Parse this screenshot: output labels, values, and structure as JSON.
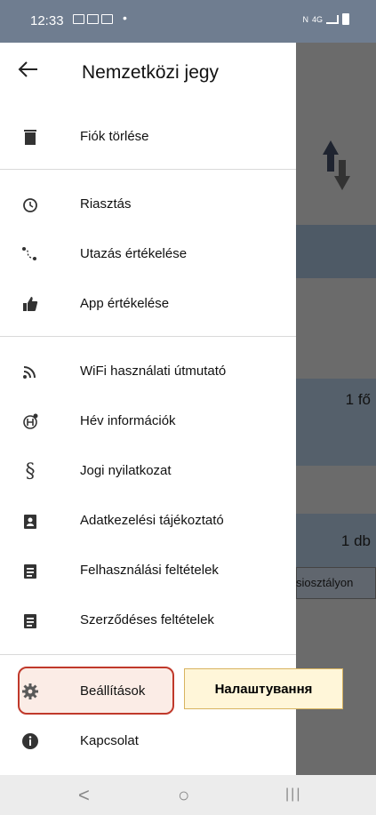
{
  "status": {
    "time": "12:33",
    "dot": "•",
    "network": "4G"
  },
  "appbar": {
    "title": "Nemzetközi jegy"
  },
  "background": {
    "persons": "1 fő",
    "count": "1 db",
    "class_partial": "siosztályon"
  },
  "menu": {
    "section1": [
      {
        "label": "Fiók törlése",
        "icon": "trash-icon"
      }
    ],
    "section2": [
      {
        "label": "Riasztás",
        "icon": "alarm-clock-icon"
      },
      {
        "label": "Utazás értékelése",
        "icon": "route-rating-icon"
      },
      {
        "label": "App értékelése",
        "icon": "thumbs-up-icon"
      }
    ],
    "section3": [
      {
        "label": "WiFi használati útmutató",
        "icon": "wifi-icon"
      },
      {
        "label": "Hév információk",
        "icon": "hev-info-icon"
      },
      {
        "label": "Jogi nyilatkozat",
        "icon": "section-sign-icon"
      },
      {
        "label": "Adatkezelési tájékoztató",
        "icon": "id-badge-icon"
      },
      {
        "label": "Felhasználási feltételek",
        "icon": "clipboard-icon"
      },
      {
        "label": "Szerződéses feltételek",
        "icon": "clipboard-icon"
      }
    ],
    "section4": [
      {
        "label": "Beállítások",
        "icon": "gear-icon"
      },
      {
        "label": "Kapcsolat",
        "icon": "info-icon"
      }
    ]
  },
  "tooltip": {
    "text": "Налаштування"
  },
  "navbar": {
    "back": "<",
    "home": "○",
    "recents": "|||"
  }
}
